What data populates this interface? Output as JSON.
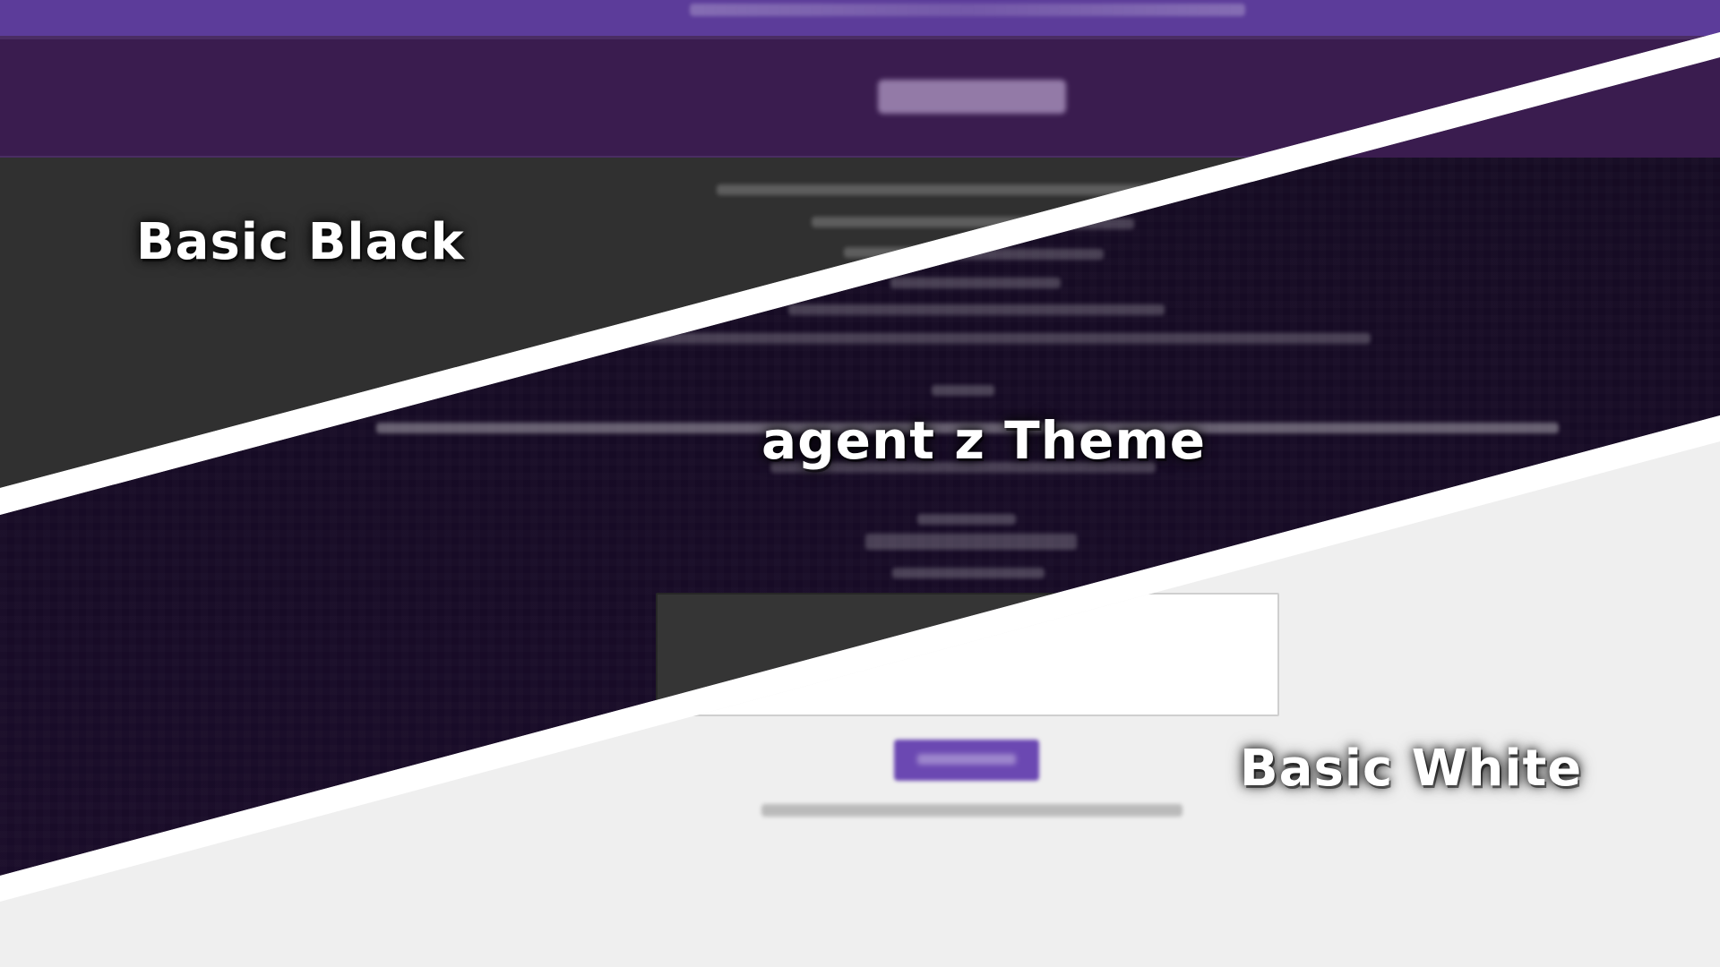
{
  "labels": {
    "basic_black": "Basic Black",
    "agent_theme": "agent z Theme",
    "basic_white": "Basic White"
  },
  "colors": {
    "purple_bar": "#5c3c9a",
    "header_band": "#3a1c4f",
    "basic_black_bg": "#303030",
    "agent_theme_bg": "#170b26",
    "basic_white_bg": "#efefef",
    "divider": "#ffffff",
    "button": "#6b48b2"
  }
}
